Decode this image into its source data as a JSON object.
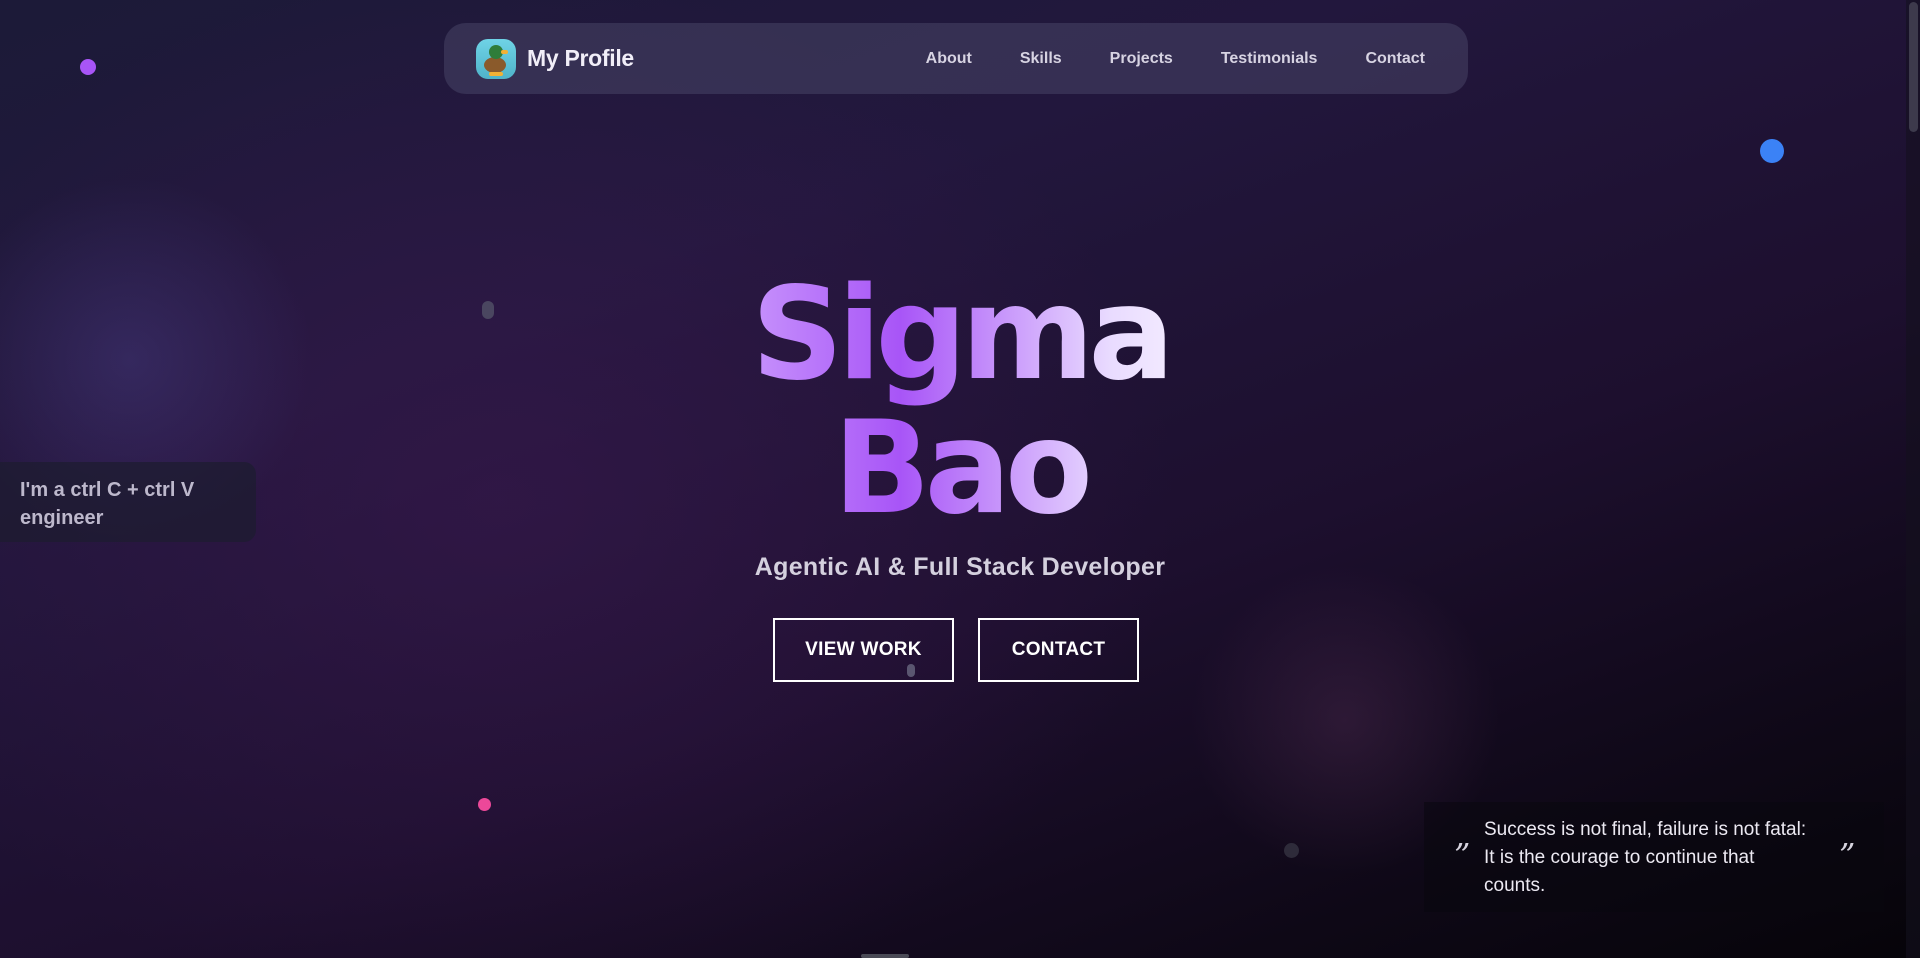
{
  "nav": {
    "brand": "My Profile",
    "logo_icon": "duck-avatar-icon",
    "links": [
      "About",
      "Skills",
      "Projects",
      "Testimonials",
      "Contact"
    ]
  },
  "tagline": "I'm a ctrl C + ctrl V engineer",
  "hero": {
    "first_name": "Sigma",
    "last_name": "Bao",
    "subtitle": "Agentic AI & Full Stack Developer",
    "primary_button": "VIEW WORK",
    "secondary_button": "CONTACT"
  },
  "quote": {
    "open_mark": "”",
    "text": "Success is not final, failure is not fatal: It is the courage to continue that counts.",
    "close_mark": "”"
  },
  "colors": {
    "accent_purple": "#a855f7",
    "dot_blue": "#3b82f6",
    "dot_pink": "#ec4899",
    "background_dark": "#1c1a38"
  }
}
